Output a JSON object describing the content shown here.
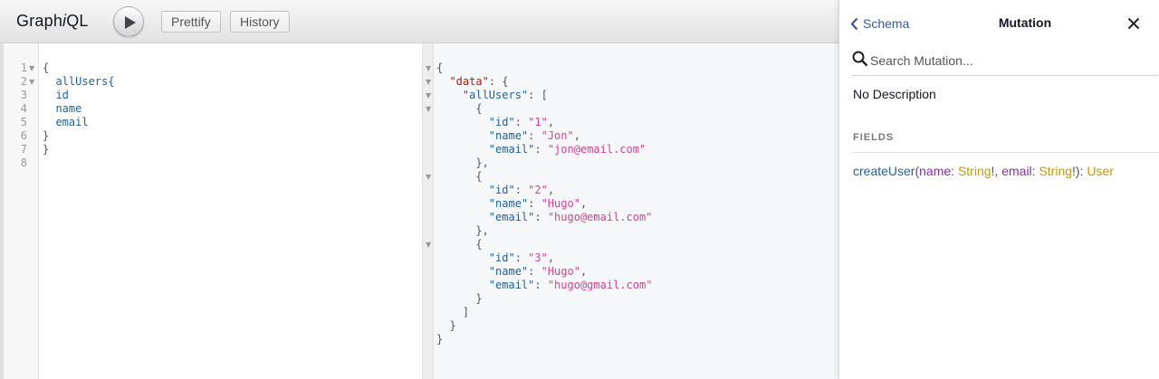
{
  "app": {
    "title_prefix": "Graph",
    "title_italic": "i",
    "title_suffix": "QL"
  },
  "toolbar": {
    "prettify_label": "Prettify",
    "history_label": "History"
  },
  "query": {
    "line_numbers": [
      "1",
      "2",
      "3",
      "4",
      "5",
      "6",
      "7",
      "8"
    ],
    "lines": {
      "l1": "{",
      "l2": "  allUsers{",
      "l3": "  id",
      "l4": "  name",
      "l5": "  email",
      "l6": "}",
      "l7": "}"
    }
  },
  "result": {
    "open_brace": "{",
    "data_key": "\"data\"",
    "colon_open": ": {",
    "all_users_key": "\"allUsers\"",
    "colon_bracket": ": [",
    "users": [
      {
        "id": "\"1\"",
        "name": "\"Jon\"",
        "email": "\"jon@email.com\""
      },
      {
        "id": "\"2\"",
        "name": "\"Hugo\"",
        "email": "\"hugo@email.com\""
      },
      {
        "id": "\"3\"",
        "name": "\"Hugo\"",
        "email": "\"hugo@gmail.com\""
      }
    ],
    "id_key": "\"id\"",
    "name_key": "\"name\"",
    "email_key": "\"email\""
  },
  "docs": {
    "back_label": "Schema",
    "title": "Mutation",
    "search_placeholder": "Search Mutation...",
    "description": "No Description",
    "fields_heading": "FIELDS",
    "field": {
      "name": "createUser",
      "arg1_name": "name",
      "arg1_type": "String",
      "arg2_name": "email",
      "arg2_type": "String",
      "return_type": "User"
    }
  },
  "colors": {
    "field_name": "#1f61a0",
    "argument": "#8b2bb9",
    "type": "#ca9800",
    "string_value": "#d64292",
    "top_key": "#b11a04",
    "link": "#3b5998"
  }
}
